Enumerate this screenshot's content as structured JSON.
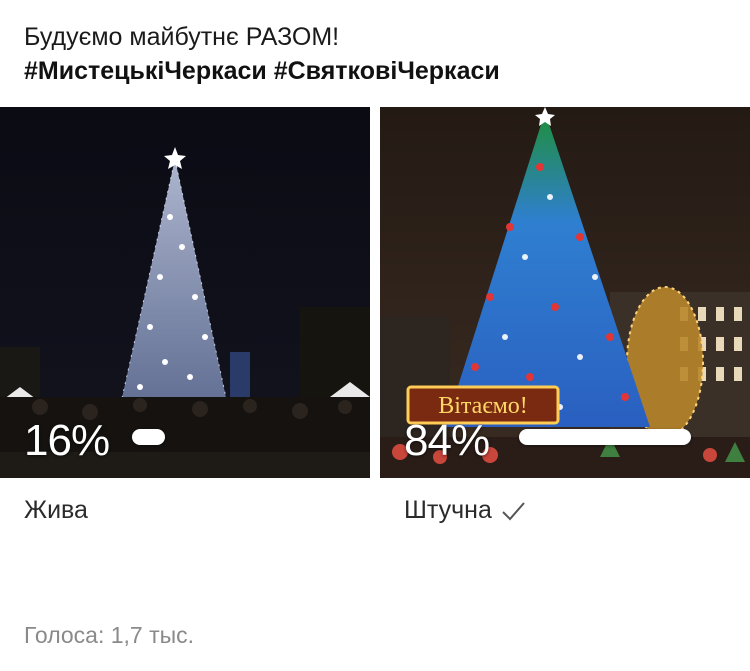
{
  "post": {
    "line1": "Будуємо майбутнє РАЗОМ!",
    "line2": "#МистецькіЧеркаси #СвятковіЧеркаси"
  },
  "poll": {
    "options": [
      {
        "label": "Жива",
        "percent_text": "16%",
        "percent": 16,
        "selected": false,
        "image": "live-christmas-tree-photo"
      },
      {
        "label": "Штучна",
        "percent_text": "84%",
        "percent": 84,
        "selected": true,
        "image": "artificial-christmas-tree-photo"
      }
    ],
    "votes_text": "Голоса: 1,7 тыс.",
    "sign_text": "Вітаємо!"
  },
  "colors": {
    "bar": "#ffffff",
    "muted": "#8a8a8a"
  },
  "icons": {
    "selected": "checkmark-icon"
  }
}
